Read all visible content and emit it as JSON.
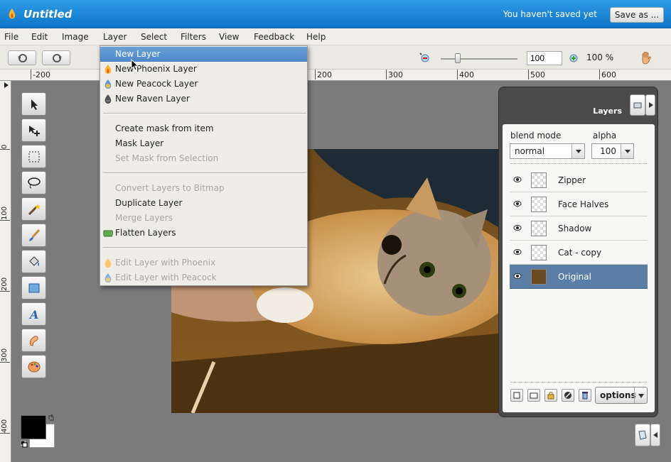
{
  "app": {
    "title": "Untitled",
    "unsaved_text": "You haven't saved yet",
    "save_as": "Save as ..."
  },
  "menubar": [
    "File",
    "Edit",
    "Image",
    "Layer",
    "Select",
    "Filters",
    "View",
    "Feedback",
    "Help"
  ],
  "zoom": {
    "value": "100",
    "percent": "100 %"
  },
  "ruler": {
    "top": [
      "-200",
      "200",
      "300",
      "400",
      "500",
      "600"
    ],
    "left": [
      "0",
      "100",
      "200",
      "300",
      "400"
    ]
  },
  "layer_menu": {
    "items": [
      {
        "label": "New Layer",
        "state": "highlighted"
      },
      {
        "label": "New Phoenix Layer",
        "icon": "phoenix-icon"
      },
      {
        "label": "New Peacock Layer",
        "icon": "peacock-icon"
      },
      {
        "label": "New Raven Layer",
        "icon": "raven-icon"
      },
      {
        "label": "Create mask from item"
      },
      {
        "label": "Mask Layer"
      },
      {
        "label": "Set Mask from Selection",
        "state": "disabled"
      },
      {
        "label": "Convert Layers to Bitmap",
        "state": "disabled"
      },
      {
        "label": "Duplicate Layer"
      },
      {
        "label": "Merge Layers",
        "state": "disabled"
      },
      {
        "label": "Flatten Layers",
        "icon": "flatten-icon"
      },
      {
        "label": "Edit Layer with Phoenix",
        "state": "disabled",
        "icon": "phoenix-icon"
      },
      {
        "label": "Edit Layer with Peacock",
        "state": "disabled",
        "icon": "peacock-icon"
      }
    ]
  },
  "layers_panel": {
    "title": "Layers",
    "blend_label": "blend mode",
    "blend_value": "normal",
    "alpha_label": "alpha",
    "alpha_value": "100",
    "layers": [
      {
        "name": "Zipper"
      },
      {
        "name": "Face Halves"
      },
      {
        "name": "Shadow"
      },
      {
        "name": "Cat - copy"
      },
      {
        "name": "Original",
        "selected": true
      }
    ],
    "options_label": "options"
  },
  "colors": {
    "accent": "#1a86d6",
    "selection": "#5b7ea6",
    "foreground": "#000000",
    "background": "#ffffff"
  }
}
